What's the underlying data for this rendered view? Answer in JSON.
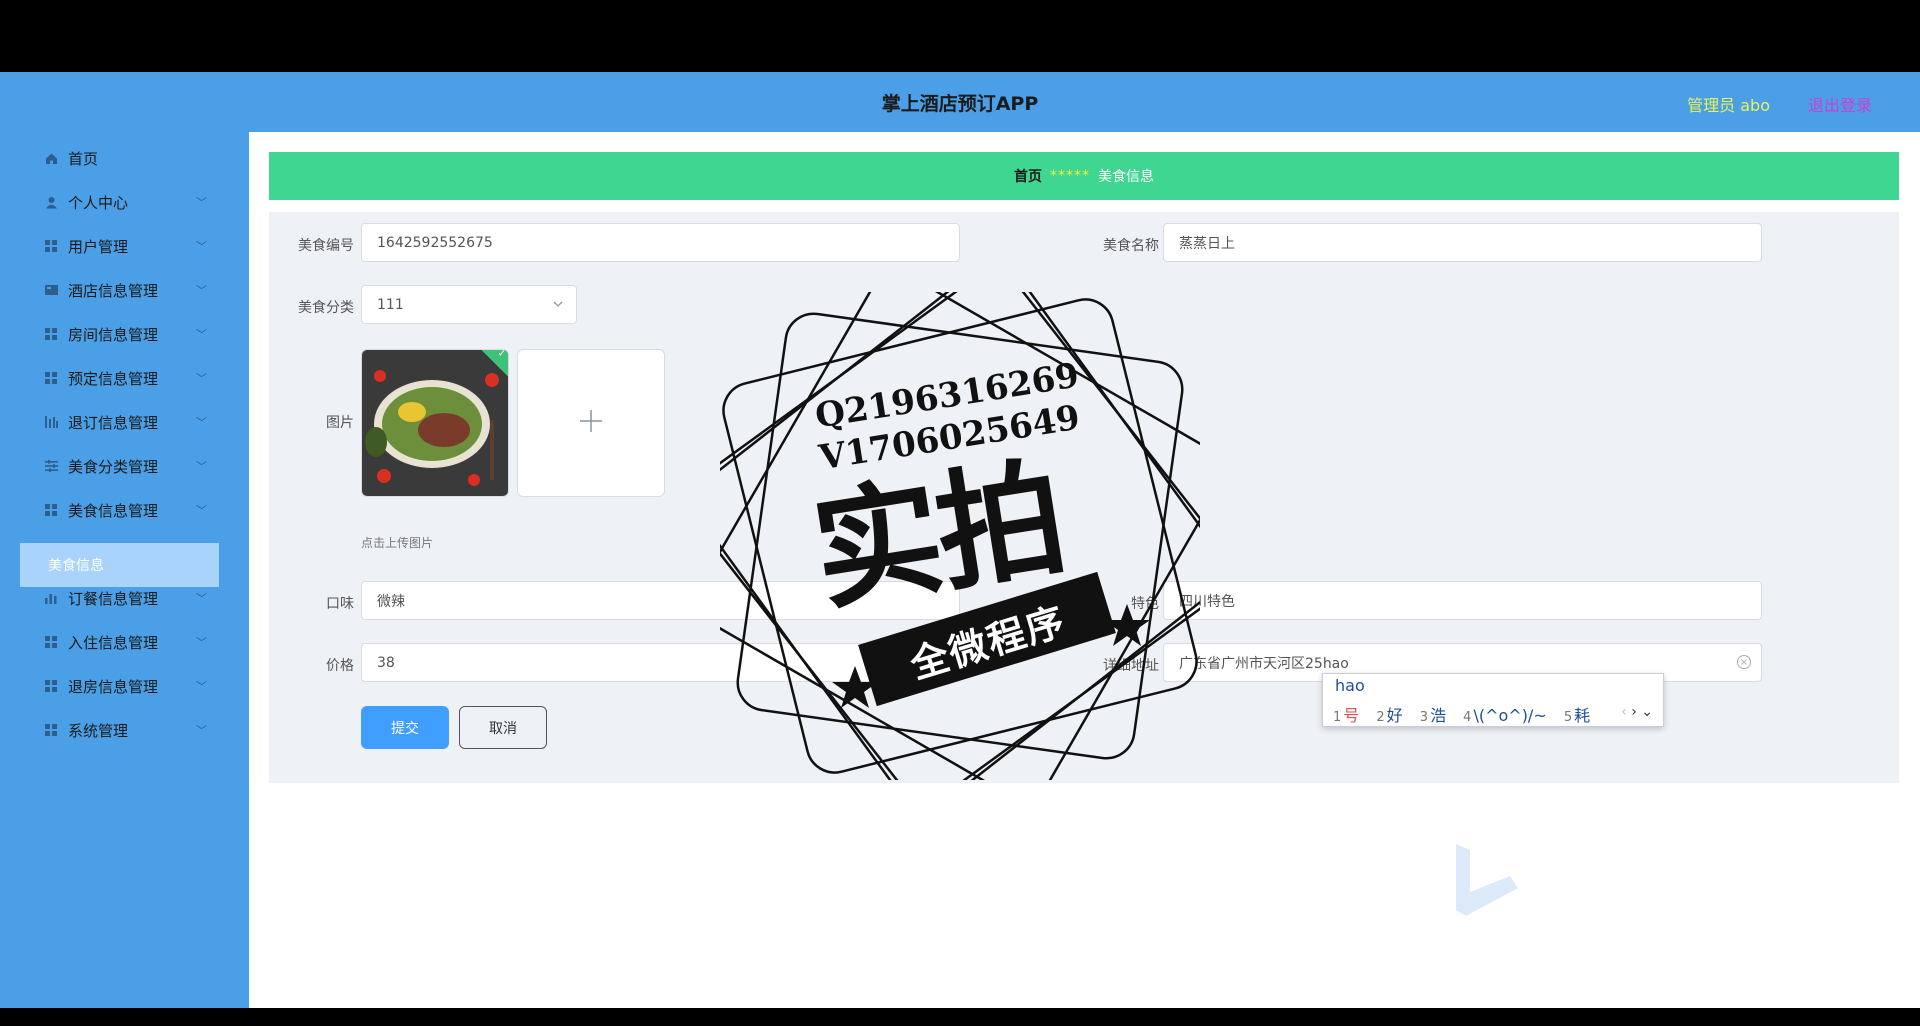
{
  "header": {
    "title": "掌上酒店预订APP",
    "admin_label": "管理员 abo",
    "logout_label": "退出登录"
  },
  "sidebar": {
    "items": [
      {
        "label": "首页",
        "icon": "home-icon",
        "has_children": false
      },
      {
        "label": "个人中心",
        "icon": "user-icon",
        "has_children": true
      },
      {
        "label": "用户管理",
        "icon": "grid-icon",
        "has_children": true
      },
      {
        "label": "酒店信息管理",
        "icon": "card-icon",
        "has_children": true
      },
      {
        "label": "房间信息管理",
        "icon": "grid-icon",
        "has_children": true
      },
      {
        "label": "预定信息管理",
        "icon": "grid-icon",
        "has_children": true
      },
      {
        "label": "退订信息管理",
        "icon": "chart-icon",
        "has_children": true
      },
      {
        "label": "美食分类管理",
        "icon": "sliders-icon",
        "has_children": true
      },
      {
        "label": "美食信息管理",
        "icon": "grid-icon",
        "has_children": true
      },
      {
        "label": "订餐信息管理",
        "icon": "bar-chart-icon",
        "has_children": true
      },
      {
        "label": "入住信息管理",
        "icon": "grid-icon",
        "has_children": true
      },
      {
        "label": "退房信息管理",
        "icon": "grid-icon",
        "has_children": true
      },
      {
        "label": "系统管理",
        "icon": "grid-icon",
        "has_children": true
      }
    ],
    "active_sub": "美食信息"
  },
  "breadcrumb": {
    "home": "首页",
    "separator": "*****",
    "current": "美食信息"
  },
  "form": {
    "food_no_label": "美食编号",
    "food_no_value": "1642592552675",
    "food_name_label": "美食名称",
    "food_name_value": "蒸蒸日上",
    "category_label": "美食分类",
    "category_value": "111",
    "image_label": "图片",
    "upload_hint": "点击上传图片",
    "taste_label": "口味",
    "taste_value": "微辣",
    "feature_label": "特色",
    "feature_value": "四川特色",
    "price_label": "价格",
    "price_value": "38",
    "address_label": "详细地址",
    "address_value": "广东省广州市天河区25hao",
    "submit_label": "提交",
    "cancel_label": "取消"
  },
  "ime": {
    "input": "hao",
    "candidates": [
      {
        "num": "1",
        "text": "号"
      },
      {
        "num": "2",
        "text": "好"
      },
      {
        "num": "3",
        "text": "浩"
      },
      {
        "num": "4",
        "text": "\\(^o^)/~"
      },
      {
        "num": "5",
        "text": "耗"
      }
    ]
  },
  "stamp": {
    "line1": "Q2196316269",
    "line2": "V1706025649",
    "big": "实拍",
    "banner": "全微程序"
  },
  "colors": {
    "header_bg": "#4a9fe6",
    "breadcrumb_bg": "#3ed690",
    "submit_bg": "#409eff"
  }
}
